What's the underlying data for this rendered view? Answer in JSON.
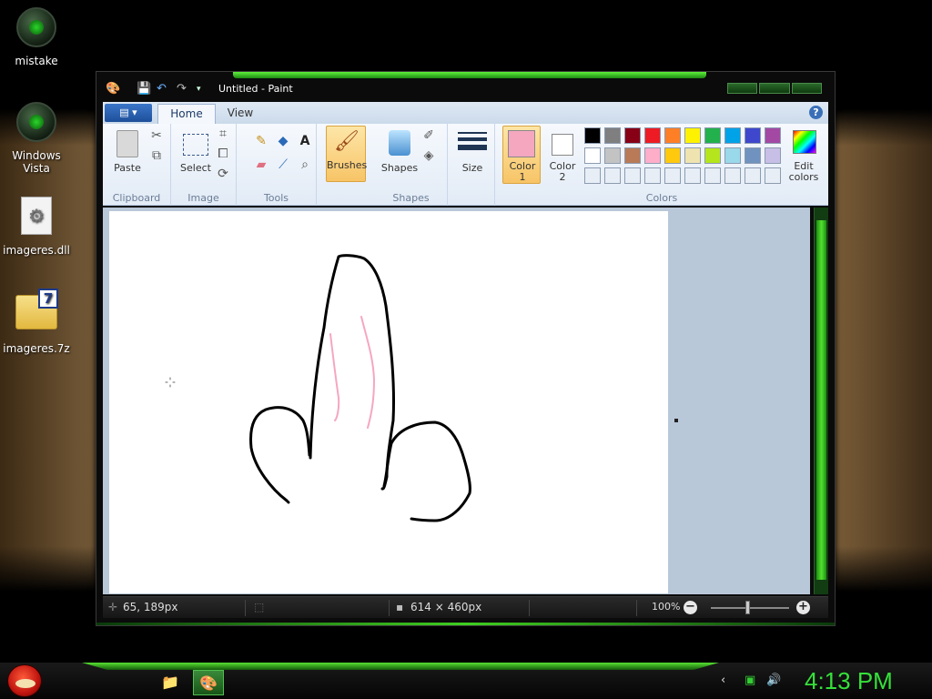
{
  "desktop": {
    "icons": [
      {
        "label": "mistake"
      },
      {
        "label": "Windows Vista"
      },
      {
        "label": "imageres.dll"
      },
      {
        "label": "imageres.7z"
      }
    ]
  },
  "window": {
    "title": "Untitled - Paint",
    "file_menu_glyph": "▤ ▾",
    "tabs": [
      {
        "label": "Home"
      },
      {
        "label": "View"
      }
    ],
    "help_glyph": "?"
  },
  "ribbon": {
    "clipboard": {
      "paste": "Paste",
      "group": "Clipboard"
    },
    "image": {
      "select": "Select",
      "group": "Image"
    },
    "tools": {
      "group": "Tools"
    },
    "brushes": {
      "label": "Brushes"
    },
    "shapes": {
      "label": "Shapes",
      "group": "Shapes"
    },
    "size": {
      "label": "Size"
    },
    "color1": {
      "label": "Color",
      "sub": "1",
      "value": "#f5a7c0"
    },
    "color2": {
      "label": "Color",
      "sub": "2",
      "value": "#ffffff"
    },
    "colors_group": "Colors",
    "edit_colors": {
      "line1": "Edit",
      "line2": "colors"
    },
    "palette_row1": [
      "#000000",
      "#7f7f7f",
      "#880015",
      "#ed1c24",
      "#ff7f27",
      "#fff200",
      "#22b14c",
      "#00a2e8",
      "#3f48cc",
      "#a349a4"
    ],
    "palette_row2": [
      "#ffffff",
      "#c3c3c3",
      "#b97a57",
      "#ffaec9",
      "#ffc90e",
      "#efe4b0",
      "#b5e61d",
      "#99d9ea",
      "#7092be",
      "#c8bfe7"
    ]
  },
  "statusbar": {
    "cursor_pos": "65, 189px",
    "canvas_size": "614 × 460px",
    "zoom": "100%"
  },
  "taskbar": {
    "clock": "4:13 PM"
  },
  "colors": {
    "accent_green": "#35e03a",
    "stroke_black": "#000000",
    "stroke_pink": "#f5a7c0"
  }
}
